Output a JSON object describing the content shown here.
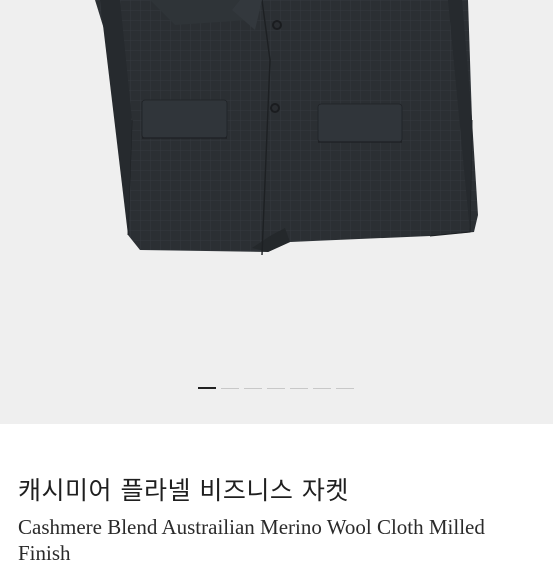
{
  "gallery": {
    "image_alt": "charcoal wool blazer",
    "slide_count": 7,
    "active_index": 0,
    "colors": {
      "background": "#efefef",
      "fabric": "#2b2f33",
      "indicator_active": "#222222",
      "indicator_inactive": "#c8c8c8"
    }
  },
  "product": {
    "title_ko": "캐시미어 플라넬 비즈니스 자켓",
    "title_en": "Cashmere Blend Austrailian Merino Wool Cloth Milled Finish"
  }
}
